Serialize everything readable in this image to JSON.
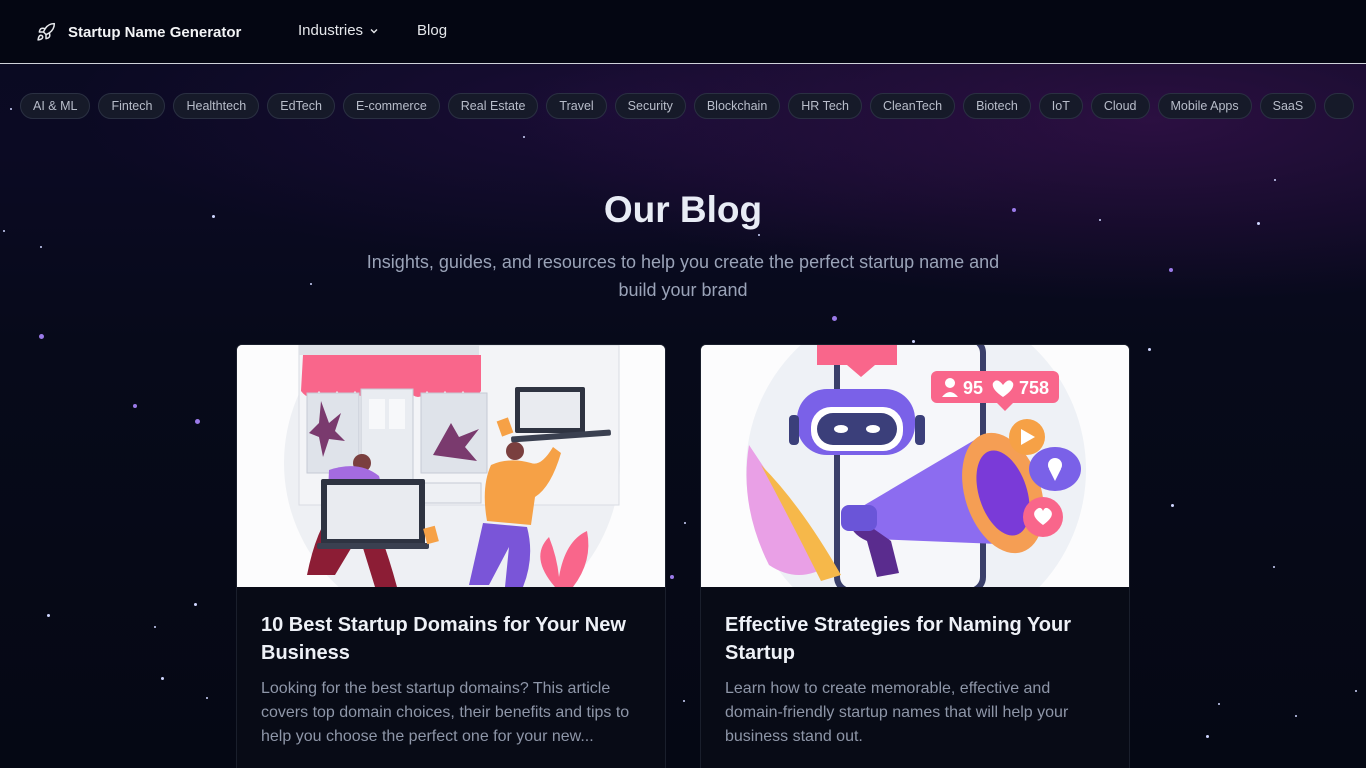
{
  "header": {
    "brand": "Startup Name Generator",
    "nav": {
      "industries": "Industries",
      "blog": "Blog"
    }
  },
  "tags": [
    "AI & ML",
    "Fintech",
    "Healthtech",
    "EdTech",
    "E-commerce",
    "Real Estate",
    "Travel",
    "Security",
    "Blockchain",
    "HR Tech",
    "CleanTech",
    "Biotech",
    "IoT",
    "Cloud",
    "Mobile Apps",
    "SaaS"
  ],
  "hero": {
    "title": "Our Blog",
    "subtitle": "Insights, guides, and resources to help you create the perfect startup name and build your brand"
  },
  "posts": [
    {
      "title": "10 Best Startup Domains for Your New Business",
      "excerpt": "Looking for the best startup domains? This article covers top domain choices, their benefits and tips to help you choose the perfect one for your new..."
    },
    {
      "title": "Effective Strategies for Naming Your Startup",
      "excerpt": "Learn how to create memorable, effective and domain-friendly startup names that will help your business stand out."
    }
  ],
  "icons": {
    "brand": "rocket-icon",
    "nav_dropdown": "chevron-down-icon"
  },
  "colors": {
    "background": "#050814",
    "header": "#040612",
    "tag_bg": "#161a29",
    "accent_pink": "#f9668b",
    "accent_purple": "#7b61e8"
  }
}
